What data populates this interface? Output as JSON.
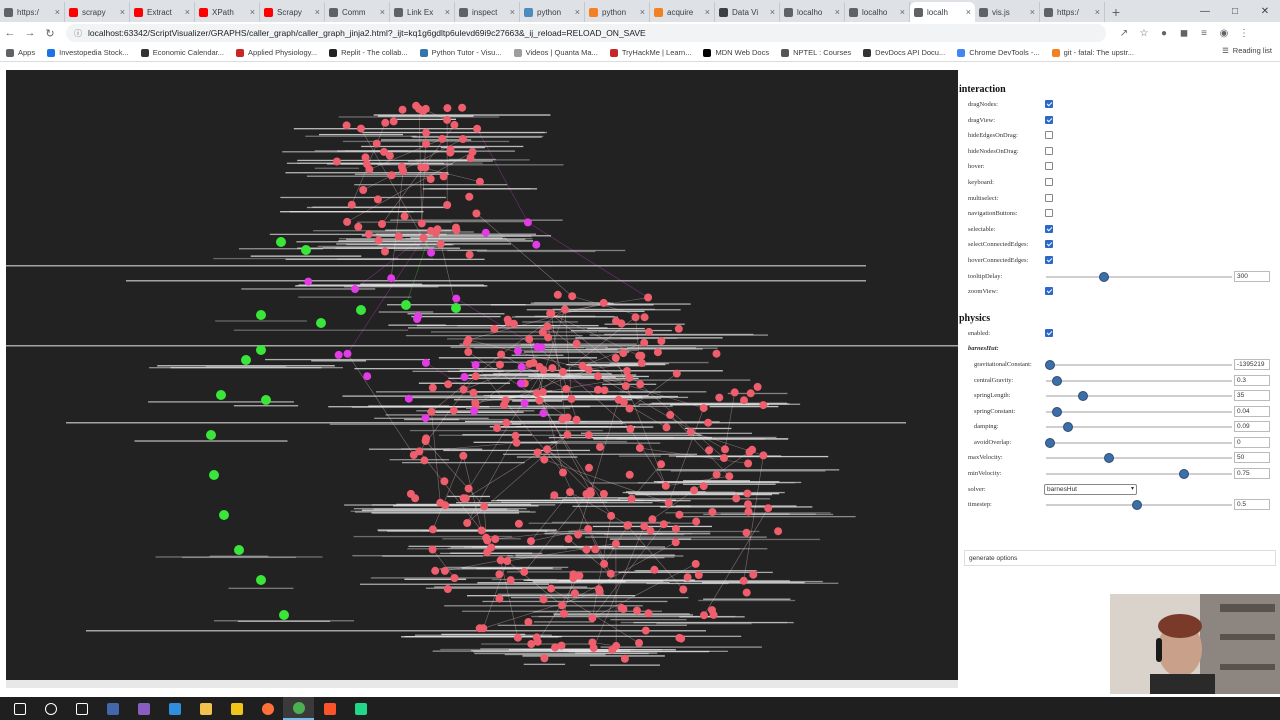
{
  "browser": {
    "tabs": [
      {
        "label": "https:/",
        "color": "#5f6368"
      },
      {
        "label": "scrapy",
        "color": "#ff0000"
      },
      {
        "label": "Extract",
        "color": "#ff0000"
      },
      {
        "label": "XPath",
        "color": "#ff0000"
      },
      {
        "label": "Scrapy",
        "color": "#ff0000"
      },
      {
        "label": "Comm",
        "color": "#5f6368"
      },
      {
        "label": "Link Ex",
        "color": "#5f6368"
      },
      {
        "label": "inspect",
        "color": "#5f6368"
      },
      {
        "label": "python",
        "color": "#4b8bbe"
      },
      {
        "label": "python",
        "color": "#f48024"
      },
      {
        "label": "acquire",
        "color": "#f48024"
      },
      {
        "label": "Data Vi",
        "color": "#3c4043"
      },
      {
        "label": "localho",
        "color": "#5f6368"
      },
      {
        "label": "localho",
        "color": "#5f6368"
      },
      {
        "label": "localh",
        "color": "#5f6368",
        "active": true
      },
      {
        "label": "vis.js",
        "color": "#5f6368"
      },
      {
        "label": "https:/",
        "color": "#5f6368"
      }
    ],
    "url": "localhost:63342/ScriptVisualizer/GRAPHS/caller_graph/caller_graph_jinja2.html?_ijt=kq1g6gdltp6ulevd69i9c27663&_ij_reload=RELOAD_ON_SAVE",
    "bookmarks": [
      {
        "label": "Apps",
        "color": "#5f6368"
      },
      {
        "label": "Investopedia Stock...",
        "color": "#1a73e8"
      },
      {
        "label": "Economic Calendar...",
        "color": "#333333"
      },
      {
        "label": "Applied Physiology...",
        "color": "#c62828"
      },
      {
        "label": "Replit - The collab...",
        "color": "#222222"
      },
      {
        "label": "Python Tutor - Visu...",
        "color": "#3776ab"
      },
      {
        "label": "Videos | Quanta Ma...",
        "color": "#9e9e9e"
      },
      {
        "label": "TryHackMe | Learn...",
        "color": "#c62828"
      },
      {
        "label": "MDN Web Docs",
        "color": "#000000"
      },
      {
        "label": "NPTEL : Courses",
        "color": "#555555"
      },
      {
        "label": "DevDocs API Docu...",
        "color": "#333333"
      },
      {
        "label": "Chrome DevTools -...",
        "color": "#4285f4"
      },
      {
        "label": "git - fatal: The upstr...",
        "color": "#f48024"
      }
    ],
    "reading_list": "Reading list"
  },
  "config": {
    "interaction": {
      "title": "interaction",
      "options": [
        {
          "label": "dragNodes:",
          "type": "checkbox",
          "checked": true
        },
        {
          "label": "dragView:",
          "type": "checkbox",
          "checked": true
        },
        {
          "label": "hideEdgesOnDrag:",
          "type": "checkbox",
          "checked": false
        },
        {
          "label": "hideNodesOnDrag:",
          "type": "checkbox",
          "checked": false
        },
        {
          "label": "hover:",
          "type": "checkbox",
          "checked": false
        },
        {
          "label": "keyboard:",
          "type": "checkbox",
          "checked": false
        },
        {
          "label": "multiselect:",
          "type": "checkbox",
          "checked": false
        },
        {
          "label": "navigationButtons:",
          "type": "checkbox",
          "checked": false
        },
        {
          "label": "selectable:",
          "type": "checkbox",
          "checked": true
        },
        {
          "label": "selectConnectedEdges:",
          "type": "checkbox",
          "checked": true
        },
        {
          "label": "hoverConnectedEdges:",
          "type": "checkbox",
          "checked": true
        },
        {
          "label": "tooltipDelay:",
          "type": "slider",
          "value": "300",
          "fraction": 0.31
        },
        {
          "label": "zoomView:",
          "type": "checkbox",
          "checked": true
        }
      ]
    },
    "physics": {
      "title": "physics",
      "options": [
        {
          "label": "enabled:",
          "type": "checkbox",
          "checked": true
        },
        {
          "label": "barnesHut:",
          "type": "header"
        },
        {
          "label": "gravitationalConstant:",
          "type": "slider",
          "value": "-1395219",
          "fraction": 0.02,
          "sub": true
        },
        {
          "label": "centralGravity:",
          "type": "slider",
          "value": "0.3",
          "fraction": 0.06,
          "sub": true
        },
        {
          "label": "springLength:",
          "type": "slider",
          "value": "35",
          "fraction": 0.2,
          "sub": true
        },
        {
          "label": "springConstant:",
          "type": "slider",
          "value": "0.04",
          "fraction": 0.06,
          "sub": true
        },
        {
          "label": "damping:",
          "type": "slider",
          "value": "0.09",
          "fraction": 0.12,
          "sub": true
        },
        {
          "label": "avoidOverlap:",
          "type": "slider",
          "value": "0",
          "fraction": 0.02,
          "sub": true
        },
        {
          "label": "maxVelocity:",
          "type": "slider",
          "value": "50",
          "fraction": 0.34
        },
        {
          "label": "minVelocity:",
          "type": "slider",
          "value": "0.75",
          "fraction": 0.74
        },
        {
          "label": "solver:",
          "type": "select",
          "value": "barnesHut"
        },
        {
          "label": "timestep:",
          "type": "slider",
          "value": "0.5",
          "fraction": 0.49
        }
      ]
    },
    "generate_button": "generate options"
  },
  "graph": {
    "background": "#222222",
    "node_colors": {
      "red": "#ef5e6c",
      "green": "#39e639",
      "magenta": "#e33be6"
    }
  },
  "taskbar": {
    "icons": [
      {
        "name": "windows-start-icon",
        "color": "#ffffff"
      },
      {
        "name": "search-icon",
        "color": "#ffffff"
      },
      {
        "name": "task-view-icon",
        "color": "#ffffff"
      },
      {
        "name": "app-icon",
        "color": "#4466aa"
      },
      {
        "name": "visual-studio-icon",
        "color": "#8a5dc1"
      },
      {
        "name": "vscode-icon",
        "color": "#2f8fdd"
      },
      {
        "name": "file-explorer-icon",
        "color": "#f2c14e"
      },
      {
        "name": "python-icon",
        "color": "#f0c419"
      },
      {
        "name": "firefox-icon",
        "color": "#ff7139"
      },
      {
        "name": "chrome-icon",
        "color": "#4caf50",
        "active": true
      },
      {
        "name": "brave-icon",
        "color": "#fb542b"
      },
      {
        "name": "pycharm-icon",
        "color": "#21d789"
      }
    ]
  }
}
